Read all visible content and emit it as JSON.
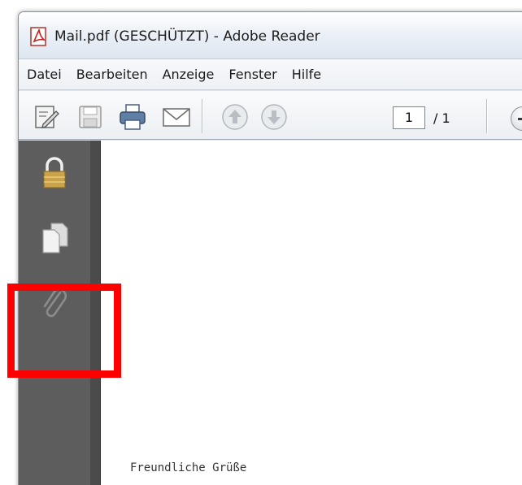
{
  "window": {
    "title": "Mail.pdf (GESCHÜTZT) - Adobe Reader",
    "icon": "pdf-file-icon"
  },
  "menu": {
    "items": [
      "Datei",
      "Bearbeiten",
      "Anzeige",
      "Fenster",
      "Hilfe"
    ]
  },
  "toolbar": {
    "buttons": [
      "edit-document-icon",
      "save-icon",
      "print-icon",
      "email-icon",
      "previous-page-icon",
      "next-page-icon",
      "zoom-out-icon"
    ],
    "page_current": "1",
    "page_total": "/ 1"
  },
  "sidebar": {
    "icons": [
      "lock-icon",
      "pages-icon",
      "paperclip-icon"
    ]
  },
  "document": {
    "text": "Freundliche Grüße"
  },
  "colors": {
    "highlight": "#ff0000",
    "sidebar": "#5d5d5d",
    "lock": "#c9a24a"
  }
}
